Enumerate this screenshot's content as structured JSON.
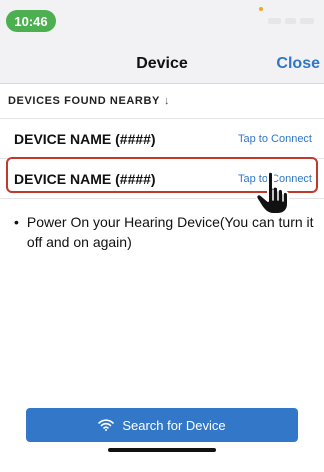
{
  "status_bar": {
    "time": "10:46"
  },
  "nav": {
    "title": "Device",
    "close_label": "Close"
  },
  "section": {
    "header": "DEVICES FOUND NEARBY",
    "sort_icon": "down-arrow-icon"
  },
  "devices": [
    {
      "name": "DEVICE NAME (####)",
      "action": "Tap to Connect"
    },
    {
      "name": "DEVICE NAME (####)",
      "action": "Tap to Connect",
      "highlighted": true
    }
  ],
  "instruction": {
    "text": "Power On your Hearing Device(You can turn it off and on again)"
  },
  "search_button": {
    "label": "Search for Device",
    "icon": "wifi-icon"
  },
  "colors": {
    "accent": "#3377c8",
    "link": "#2f77c9",
    "time_pill": "#4cb050",
    "highlight_border": "#c0392b"
  }
}
